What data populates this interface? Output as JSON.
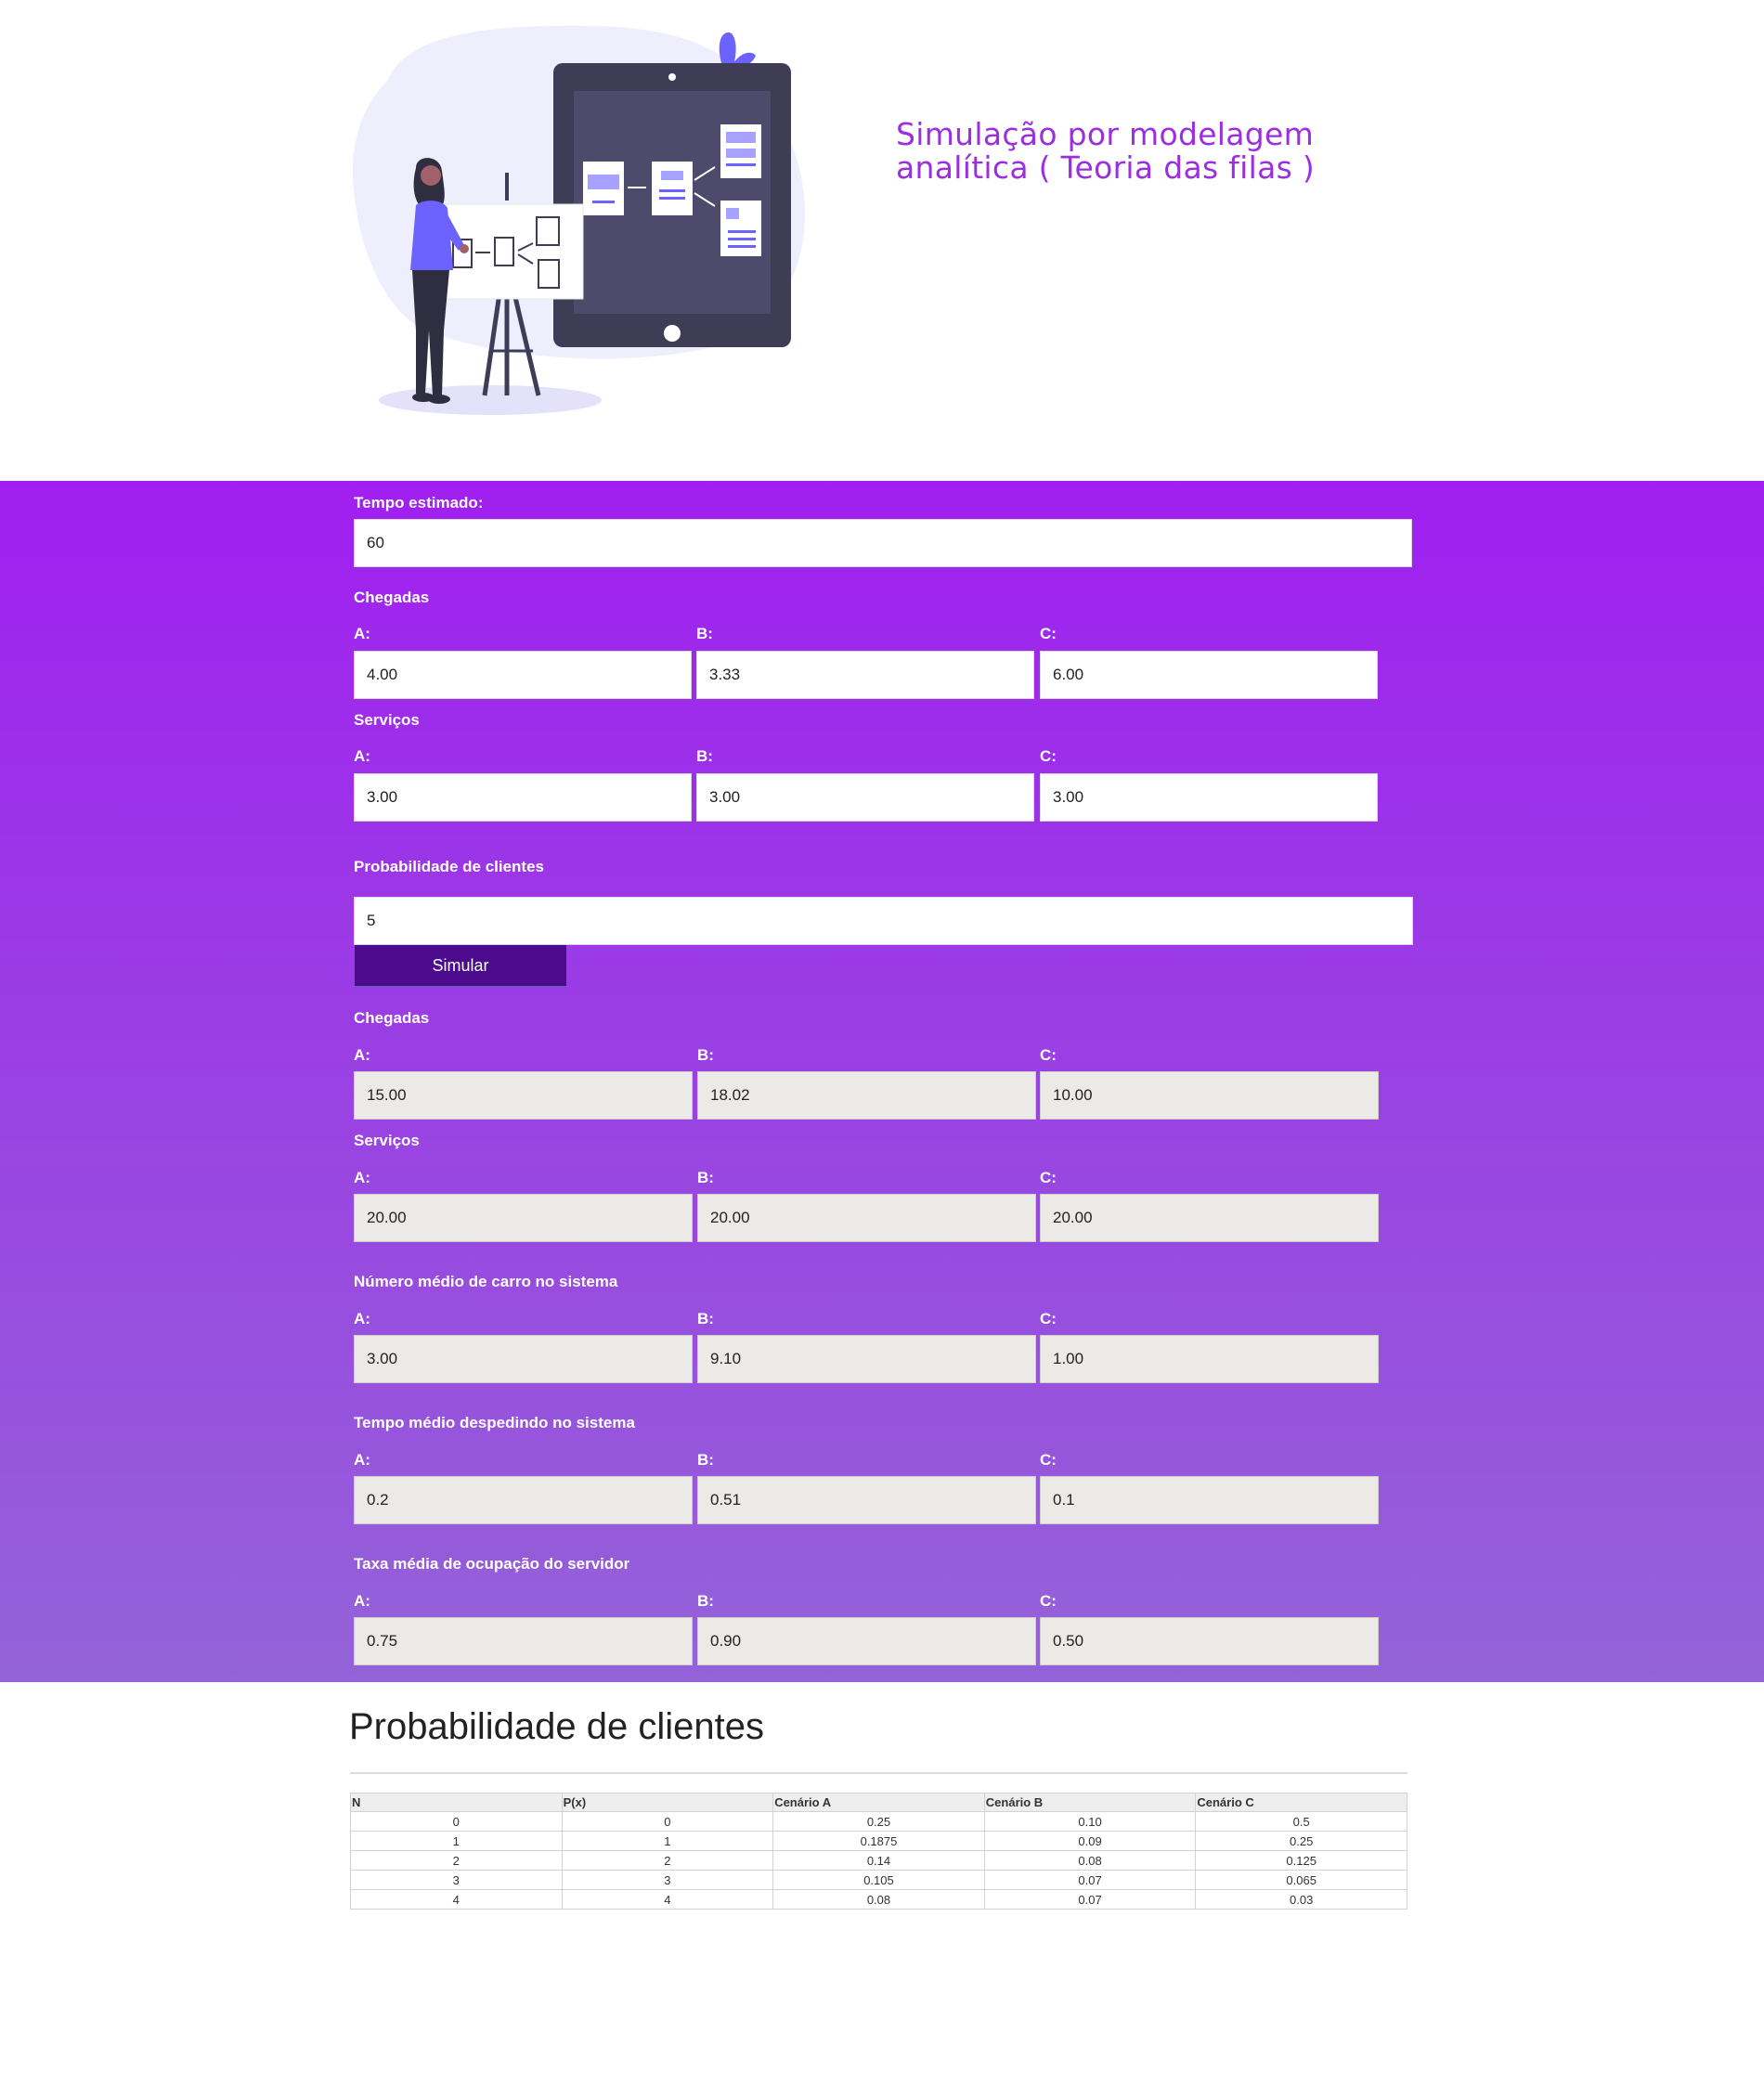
{
  "hero": {
    "title_line1": "Simulação por modelagem",
    "title_line2": "analítica ( Teoria das filas )"
  },
  "colors": {
    "accent_purple": "#9b2fe0",
    "band_top": "#a01ff0",
    "band_bottom": "#9463d8",
    "button_bg": "#4b0b8c",
    "readonly_field": "#eceae6",
    "illustration_accent": "#6c63ff",
    "tablet_body": "#3f3d56"
  },
  "form": {
    "tempo_label": "Tempo estimado:",
    "tempo_value": "60",
    "chegadas_title": "Chegadas",
    "chegadas": [
      {
        "label": "A:",
        "value": "4.00"
      },
      {
        "label": "B:",
        "value": "3.33"
      },
      {
        "label": "C:",
        "value": "6.00"
      }
    ],
    "servicos_title": "Serviços",
    "servicos": [
      {
        "label": "A:",
        "value": "3.00"
      },
      {
        "label": "B:",
        "value": "3.00"
      },
      {
        "label": "C:",
        "value": "3.00"
      }
    ],
    "prob_label": "Probabilidade de clientes",
    "prob_value": "5",
    "simulate_button": "Simular"
  },
  "results": {
    "chegadas_title": "Chegadas",
    "chegadas": [
      {
        "label": "A:",
        "value": "15.00"
      },
      {
        "label": "B:",
        "value": "18.02"
      },
      {
        "label": "C:",
        "value": "10.00"
      }
    ],
    "servicos_title": "Serviços",
    "servicos": [
      {
        "label": "A:",
        "value": "20.00"
      },
      {
        "label": "B:",
        "value": "20.00"
      },
      {
        "label": "C:",
        "value": "20.00"
      }
    ],
    "numero_medio_title": "Número médio de carro no sistema",
    "numero_medio": [
      {
        "label": "A:",
        "value": "3.00"
      },
      {
        "label": "B:",
        "value": "9.10"
      },
      {
        "label": "C:",
        "value": "1.00"
      }
    ],
    "tempo_medio_title": "Tempo médio despedindo no sistema",
    "tempo_medio": [
      {
        "label": "A:",
        "value": "0.2"
      },
      {
        "label": "B:",
        "value": "0.51"
      },
      {
        "label": "C:",
        "value": "0.1"
      }
    ],
    "taxa_media_title": "Taxa média de ocupação do servidor",
    "taxa_media": [
      {
        "label": "A:",
        "value": "0.75"
      },
      {
        "label": "B:",
        "value": "0.90"
      },
      {
        "label": "C:",
        "value": "0.50"
      }
    ]
  },
  "probability": {
    "title": "Probabilidade de clientes",
    "headers": [
      "N",
      "P(x)",
      "Cenário A",
      "Cenário B",
      "Cenário C"
    ],
    "rows": [
      [
        "0",
        "0",
        "0.25",
        "0.10",
        "0.5"
      ],
      [
        "1",
        "1",
        "0.1875",
        "0.09",
        "0.25"
      ],
      [
        "2",
        "2",
        "0.14",
        "0.08",
        "0.125"
      ],
      [
        "3",
        "3",
        "0.105",
        "0.07",
        "0.065"
      ],
      [
        "4",
        "4",
        "0.08",
        "0.07",
        "0.03"
      ]
    ]
  }
}
